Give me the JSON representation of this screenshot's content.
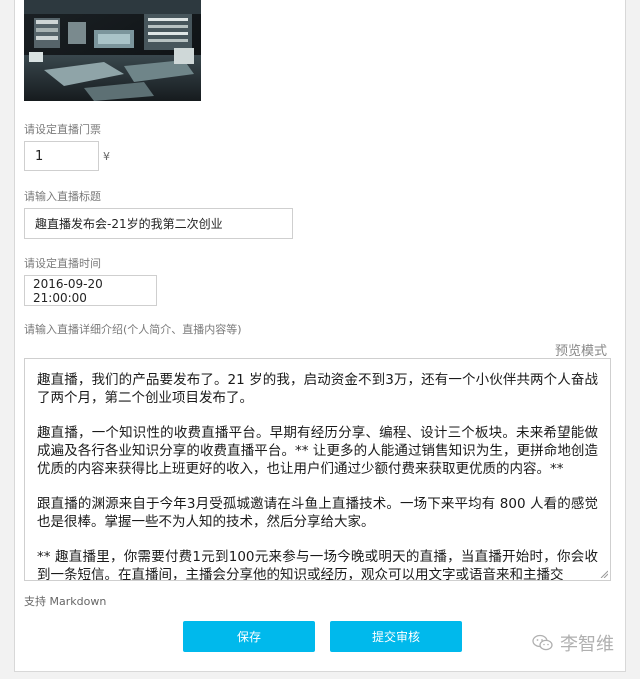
{
  "ticket": {
    "label": "请设定直播门票",
    "value": "1",
    "currency": "¥"
  },
  "title_field": {
    "label": "请输入直播标题",
    "value": "趣直播发布会-21岁的我第二次创业"
  },
  "time_field": {
    "label": "请设定直播时间",
    "value": "2016-09-20 21:00:00"
  },
  "description": {
    "label": "请输入直播详细介绍(个人简介、直播内容等)",
    "preview_label": "预览模式",
    "paragraphs": [
      "趣直播，我们的产品要发布了。21 岁的我，启动资金不到3万，还有一个小伙伴共两个人奋战了两个月，第二个创业项目发布了。",
      "趣直播，一个知识性的收费直播平台。早期有经历分享、编程、设计三个板块。未来希望能做成遍及各行各业知识分享的收费直播平台。** 让更多的人能通过销售知识为生，更拼命地创造优质的内容来获得比上班更好的收入，也让用户们通过少额付费来获取更优质的内容。**",
      "跟直播的渊源来自于今年3月受孤城邀请在斗鱼上直播技术。一场下来平均有 800 人看的感觉也是很棒。掌握一些不为人知的技术，然后分享给大家。",
      "** 趣直播里，你需要付费1元到100元来参与一场今晚或明天的直播，当直播开始时，你会收到一条短信。在直播间，主播会分享他的知识或经历，观众可以用文字或语音来和主播交"
    ],
    "markdown_note": "支持 Markdown"
  },
  "actions": {
    "save_label": "保存",
    "submit_label": "提交审核"
  },
  "watermark": {
    "text": "李智维",
    "icon": "wechat-icon"
  },
  "colors": {
    "button": "#00b9ec",
    "label": "#7a7a7a"
  }
}
